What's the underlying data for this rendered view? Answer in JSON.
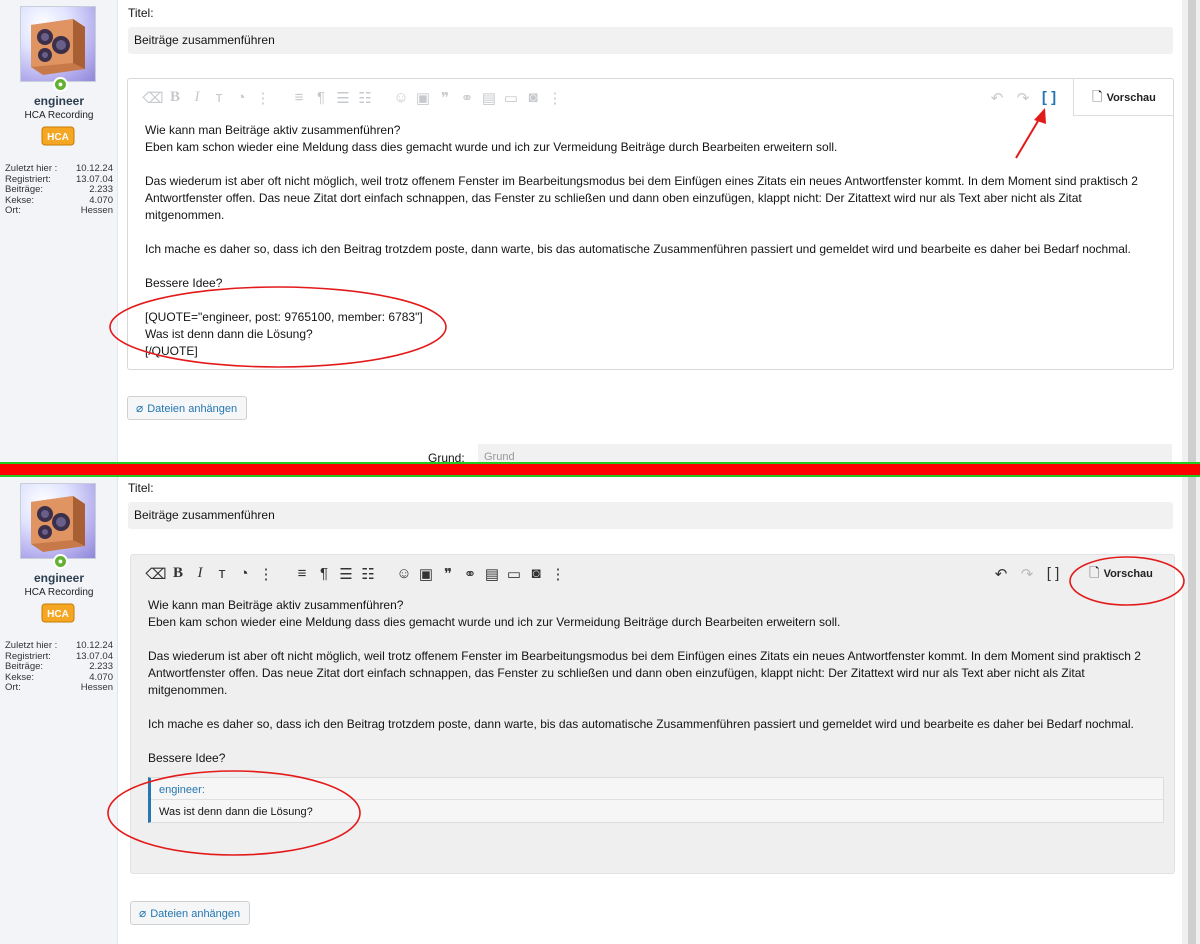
{
  "user": {
    "name": "engineer",
    "title": "HCA Recording",
    "badge_text": "HCA",
    "online_icon": "user-online-icon",
    "stats": [
      {
        "label": "Zuletzt hier :",
        "value": "10.12.24"
      },
      {
        "label": "Registriert:",
        "value": "13.07.04"
      },
      {
        "label": "Beiträge:",
        "value": "2.233"
      },
      {
        "label": "Kekse:",
        "value": "4.070"
      },
      {
        "label": "Ort:",
        "value": "Hessen"
      }
    ]
  },
  "form": {
    "title_label": "Titel:",
    "title_value": "Beiträge zusammenführen",
    "attach_label": "Dateien anhängen",
    "reason_label": "Grund:",
    "reason_placeholder": "Grund"
  },
  "toolbar": {
    "preview_label": "Vorschau",
    "icons": [
      "eraser-icon",
      "bold-icon",
      "italic-icon",
      "font-size-icon",
      "palette-icon",
      "more-icon",
      "align-icon",
      "paragraph-icon",
      "unordered-list-icon",
      "ordered-list-icon",
      "smiley-icon",
      "image-icon",
      "quote-icon",
      "link-icon",
      "media-icon",
      "video-icon",
      "camera-icon",
      "more-icon",
      "undo-icon",
      "redo-icon",
      "bbcode-toggle-icon"
    ]
  },
  "post": {
    "line1": "Wie kann man Beiträge aktiv zusammenführen?",
    "line2": "Eben kam schon wieder eine Meldung dass dies gemacht wurde und ich zur Vermeidung Beiträge durch Bearbeiten erweitern soll.",
    "para2": "Das wiederum ist aber oft nicht möglich, weil trotz offenem Fenster im Bearbeitungsmodus bei dem Einfügen eines Zitats ein neues Antwortfenster kommt. In dem Moment sind praktisch 2 Antwortfenster offen. Das neue Zitat dort einfach schnappen, das Fenster zu schließen und dann oben einzufügen, klappt nicht: Der Zitattext wird nur als Text aber nicht als Zitat mitgenommen.",
    "para3": "Ich mache es daher so, dass ich den Beitrag trotzdem poste, dann warte, bis das automatische Zusammenführen passiert und gemeldet wird und bearbeite es daher bei Bedarf nochmal.",
    "para4": "Bessere Idee?",
    "bbcode_open": "[QUOTE=\"engineer, post: 9765100, member: 6783\"]",
    "bbcode_body": "Was ist denn dann die Lösung?",
    "bbcode_close": "[/QUOTE]",
    "quote_author": "engineer:",
    "quote_body": "Was ist denn dann die Lösung?"
  },
  "annotations": {
    "color": "#e31a1a",
    "highlight_color": "#2577b1",
    "divider_color": "#ff0000",
    "divider_border": "#23c823"
  }
}
